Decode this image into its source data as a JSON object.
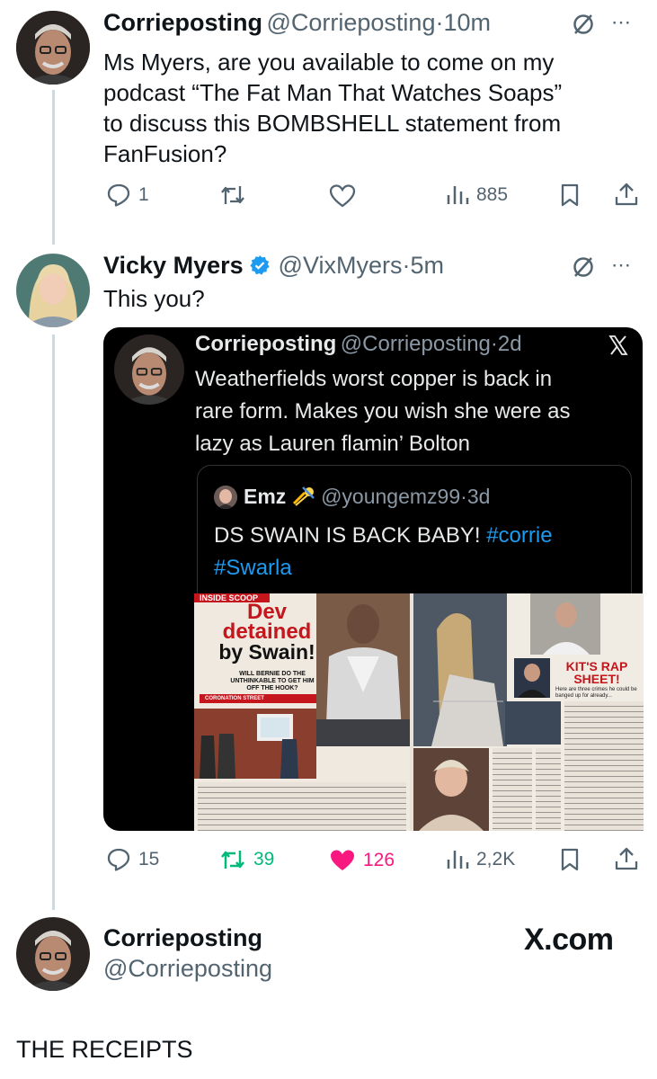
{
  "tweet1": {
    "name": "Corrieposting",
    "handle": "@Corrieposting",
    "time": "10m",
    "text_lines": [
      "Ms Myers, are you available to come on my",
      "podcast “The Fat Man That Watches Soaps”",
      "to discuss this BOMBSHELL statement from",
      "FanFusion?"
    ],
    "replies": "1",
    "views": "885"
  },
  "tweet2": {
    "name": "Vicky Myers",
    "handle": "@VixMyers",
    "time": "5m",
    "text": "This you?"
  },
  "embed": {
    "name": "Corrieposting",
    "handle": "@Corrieposting",
    "time": "2d",
    "text_lines": [
      "Weatherfields worst copper is back in",
      "rare form. Makes you wish she were as",
      "lazy as Lauren flamin’ Bolton"
    ],
    "quote": {
      "name": "Emz",
      "handle": "@youngemz99",
      "time": "3d",
      "text": "DS SWAIN IS BACK BABY!",
      "hashtag1": "#corrie",
      "hashtag2": "#Swarla"
    },
    "magazine": {
      "kicker": "INSIDE SCOOP",
      "headline1": "Dev",
      "headline2": "detained",
      "headline3": "by Swain!",
      "sub": "WILL BERNIE DO THE UNTHINKABLE TO GET HIM OFF THE HOOK?",
      "strap": "CORONATION STREET",
      "sidebar_title": "KIT'S RAP SHEET!",
      "sidebar_sub": "Here are three crimes he could be banged up for already..."
    },
    "replies": "15",
    "reposts": "39",
    "likes": "126",
    "views": "2,2K"
  },
  "footer": {
    "name": "Corrieposting",
    "handle": "@Corrieposting",
    "brand": "X.com",
    "caption": "THE RECEIPTS"
  },
  "colors": {
    "text": "#0f1419",
    "secondary": "#536471",
    "verified": "#1d9bf0",
    "repost_active": "#00ba7c",
    "like_active": "#f91880",
    "link": "#1d9bf0"
  }
}
